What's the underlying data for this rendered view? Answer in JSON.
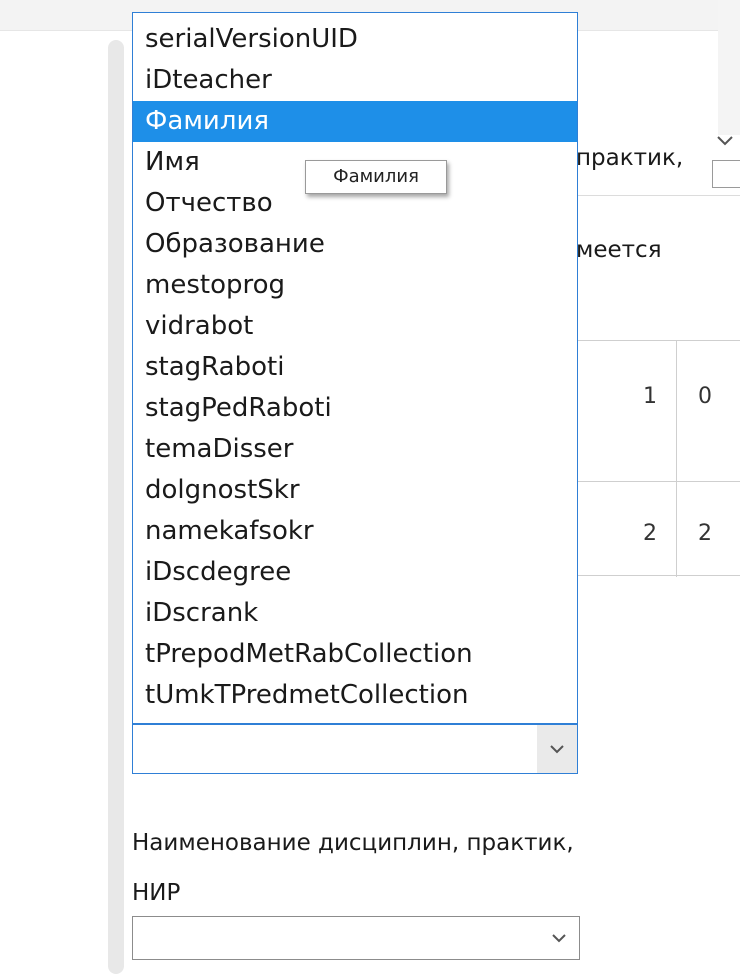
{
  "dropdown": {
    "items": [
      {
        "label": "serialVersionUID",
        "selected": false
      },
      {
        "label": "iDteacher",
        "selected": false
      },
      {
        "label": "Фамилия",
        "selected": true
      },
      {
        "label": "Имя",
        "selected": false
      },
      {
        "label": "Отчество",
        "selected": false
      },
      {
        "label": "Образование",
        "selected": false
      },
      {
        "label": "mestoprog",
        "selected": false
      },
      {
        "label": "vidrabot",
        "selected": false
      },
      {
        "label": "stagRaboti",
        "selected": false
      },
      {
        "label": "stagPedRaboti",
        "selected": false
      },
      {
        "label": "temaDisser",
        "selected": false
      },
      {
        "label": "dolgnostSkr",
        "selected": false
      },
      {
        "label": "namekafsokr",
        "selected": false
      },
      {
        "label": "iDscdegree",
        "selected": false
      },
      {
        "label": "iDscrank",
        "selected": false
      },
      {
        "label": "tPrepodMetRabCollection",
        "selected": false
      },
      {
        "label": "tUmkTPredmetCollection",
        "selected": false
      }
    ],
    "highlight_color": "#1e8fe8",
    "border_color": "#2f7fd6"
  },
  "tooltip": {
    "text": "Фамилия"
  },
  "teacher_select": {
    "value": ""
  },
  "discipline_field": {
    "label_line1": "Наименование дисциплин, практик,",
    "label_line2": "НИР",
    "value": ""
  },
  "background": {
    "label_fragment_1": "практик,",
    "label_fragment_2": "меется",
    "table": {
      "rows": [
        [
          "1",
          "0"
        ],
        [
          "2",
          "2"
        ]
      ]
    }
  }
}
